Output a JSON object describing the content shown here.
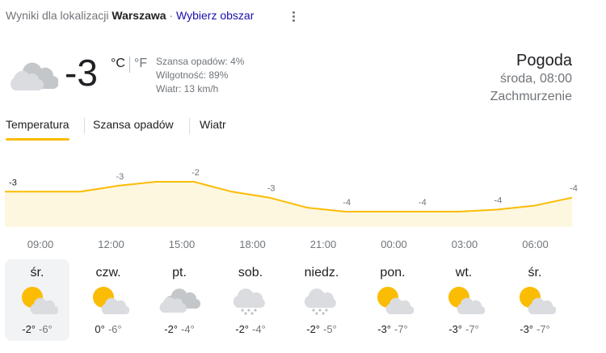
{
  "location": {
    "prefix": "Wyniki dla lokalizacji",
    "city": "Warszawa",
    "separator": "·",
    "choose_area": "Wybierz obszar"
  },
  "current": {
    "temp": "-3",
    "unit_c": "°C",
    "unit_f": "°F",
    "precip": "Szansa opadów: 4%",
    "humidity": "Wilgotność: 89%",
    "wind": "Wiatr: 13 km/h",
    "icon": "cloudy-icon"
  },
  "header": {
    "title": "Pogoda",
    "datetime": "środa, 08:00",
    "condition": "Zachmurzenie"
  },
  "tabs": [
    "Temperatura",
    "Szansa opadów",
    "Wiatr"
  ],
  "colors": {
    "accent": "#fbbc04",
    "chart_fill": "#fef7e0",
    "text": "#202124",
    "muted": "#70757a",
    "link": "#1a0dab"
  },
  "chart_data": {
    "type": "area",
    "x": [
      "09:00",
      "",
      "12:00",
      "",
      "15:00",
      "",
      "18:00",
      "",
      "21:00",
      "",
      "00:00",
      "",
      "03:00",
      "",
      "06:00",
      ""
    ],
    "series": [
      {
        "values": [
          -3,
          -3,
          -3,
          -2.7,
          -2.5,
          -2.5,
          -3,
          -3.3,
          -3.8,
          -4,
          -4,
          -4,
          -4,
          -3.9,
          -3.7,
          -3.3
        ]
      }
    ],
    "data_labels": [
      {
        "index": 0,
        "label": "-3"
      },
      {
        "index": 3,
        "label": "-3"
      },
      {
        "index": 5,
        "label": "-2"
      },
      {
        "index": 7,
        "label": "-3"
      },
      {
        "index": 9,
        "label": "-4"
      },
      {
        "index": 11,
        "label": "-4"
      },
      {
        "index": 13,
        "label": "-4"
      },
      {
        "index": 15,
        "label": "-4"
      }
    ],
    "tick_labels": [
      "09:00",
      "12:00",
      "15:00",
      "18:00",
      "21:00",
      "00:00",
      "03:00",
      "06:00"
    ]
  },
  "days": [
    {
      "name": "śr.",
      "hi": "-2°",
      "lo": "-6°",
      "icon": "partly-cloudy-icon"
    },
    {
      "name": "czw.",
      "hi": "0°",
      "lo": "-6°",
      "icon": "partly-cloudy-icon"
    },
    {
      "name": "pt.",
      "hi": "-2°",
      "lo": "-4°",
      "icon": "cloudy-icon"
    },
    {
      "name": "sob.",
      "hi": "-2°",
      "lo": "-4°",
      "icon": "snow-icon"
    },
    {
      "name": "niedz.",
      "hi": "-2°",
      "lo": "-5°",
      "icon": "snow-icon"
    },
    {
      "name": "pon.",
      "hi": "-3°",
      "lo": "-7°",
      "icon": "partly-cloudy-icon"
    },
    {
      "name": "wt.",
      "hi": "-3°",
      "lo": "-7°",
      "icon": "partly-cloudy-icon"
    },
    {
      "name": "śr.",
      "hi": "-3°",
      "lo": "-7°",
      "icon": "partly-cloudy-icon"
    }
  ]
}
